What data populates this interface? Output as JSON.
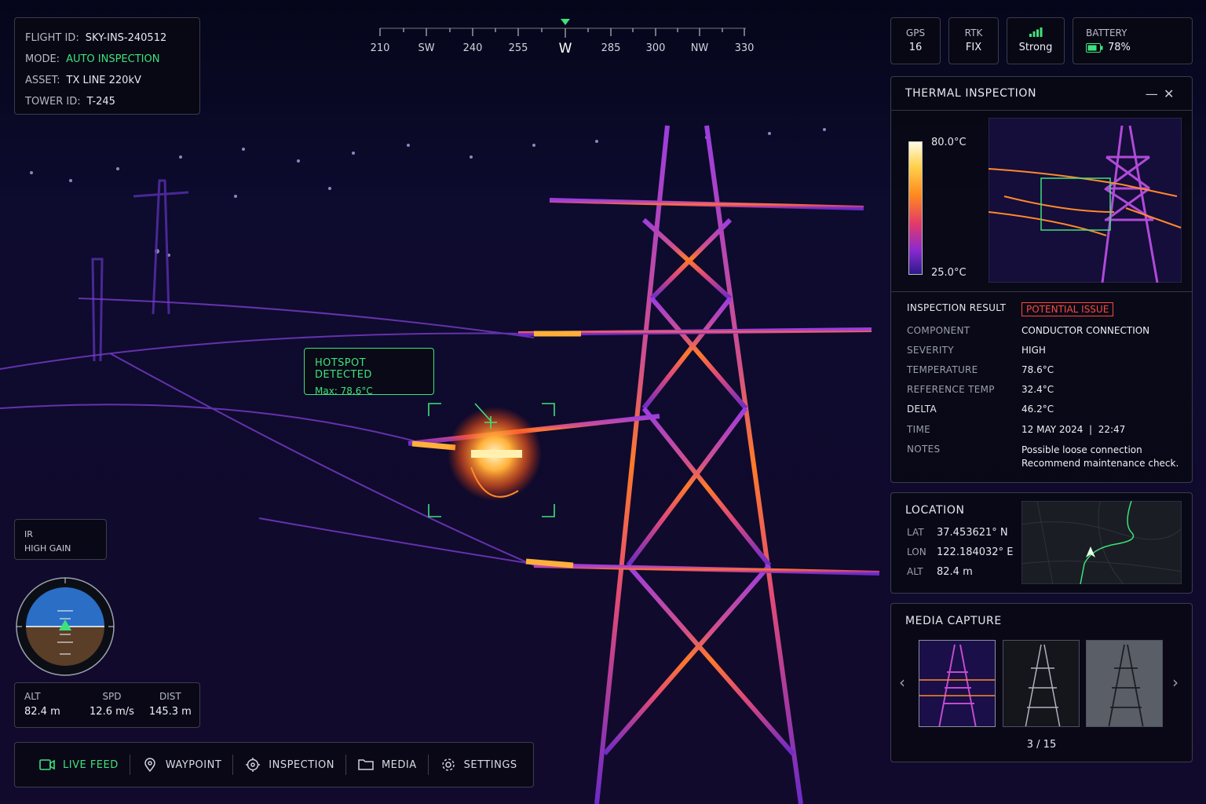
{
  "flight_info": {
    "flight_id_label": "FLIGHT ID:",
    "flight_id": "SKY-INS-240512",
    "mode_label": "MODE:",
    "mode": "AUTO INSPECTION",
    "asset_label": "ASSET:",
    "asset": "TX LINE 220kV",
    "tower_label": "TOWER ID:",
    "tower": "T-245"
  },
  "compass": {
    "labels": [
      "210",
      "SW",
      "240",
      "255",
      "W",
      "285",
      "300",
      "NW",
      "330"
    ],
    "current": "W"
  },
  "status": {
    "gps_label": "GPS",
    "gps_value": "16",
    "rtk_label": "RTK",
    "rtk_value": "FIX",
    "signal_value": "Strong",
    "battery_label": "BATTERY",
    "battery_value": "78%"
  },
  "hotspot": {
    "title": "HOTSPOT DETECTED",
    "max": "Max: 78.6°C"
  },
  "thermal": {
    "title": "THERMAL INSPECTION",
    "scale_max": "80.0°C",
    "scale_min": "25.0°C",
    "result_label": "INSPECTION RESULT",
    "result_badge": "POTENTIAL ISSUE",
    "rows": {
      "component_k": "COMPONENT",
      "component_v": "CONDUCTOR CONNECTION",
      "severity_k": "SEVERITY",
      "severity_v": "HIGH",
      "temperature_k": "TEMPERATURE",
      "temperature_v": "78.6°C",
      "ref_k": "REFERENCE TEMP",
      "ref_v": "32.4°C",
      "delta_k": "DELTA",
      "delta_v": "46.2°C",
      "time_k": "TIME",
      "time_v": "12 MAY 2024  |  22:47",
      "notes_k": "NOTES",
      "notes_v1": "Possible loose connection",
      "notes_v2": "Recommend maintenance check."
    }
  },
  "location": {
    "title": "LOCATION",
    "lat_k": "LAT",
    "lat_v": "37.453621° N",
    "lon_k": "LON",
    "lon_v": "122.184032° E",
    "alt_k": "ALT",
    "alt_v": "82.4 m"
  },
  "media": {
    "title": "MEDIA CAPTURE",
    "counter": "3 / 15"
  },
  "ir": {
    "line1": "IR",
    "line2": "HIGH GAIN"
  },
  "flight_stats": {
    "alt_k": "ALT",
    "alt_v": "82.4 m",
    "spd_k": "SPD",
    "spd_v": "12.6 m/s",
    "dist_k": "DIST",
    "dist_v": "145.3 m"
  },
  "nav": {
    "live": "LIVE FEED",
    "waypoint": "WAYPOINT",
    "inspection": "INSPECTION",
    "media": "MEDIA",
    "settings": "SETTINGS"
  }
}
